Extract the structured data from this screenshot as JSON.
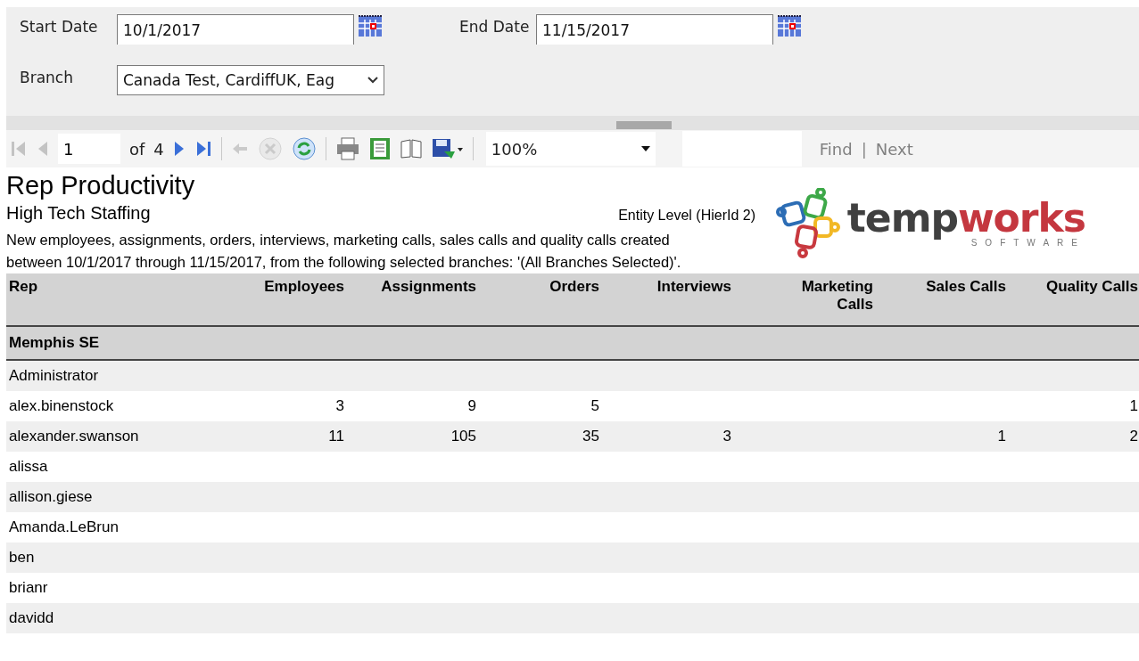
{
  "parameters": {
    "start_date": {
      "label": "Start Date",
      "value": "10/1/2017"
    },
    "end_date": {
      "label": "End Date",
      "value": "11/15/2017"
    },
    "branch": {
      "label": "Branch",
      "value": "Canada Test, CardiffUK, Eag"
    }
  },
  "toolbar": {
    "page": "1",
    "of": "of",
    "total": "4",
    "nav": [
      {
        "kind": "first",
        "disabled": true
      },
      {
        "kind": "prev",
        "disabled": true
      },
      {
        "kind": "next",
        "disabled": false
      },
      {
        "kind": "last",
        "disabled": false
      }
    ],
    "actions": [
      {
        "kind": "back",
        "disabled": true
      },
      {
        "kind": "stop",
        "disabled": true
      },
      {
        "kind": "refresh",
        "disabled": false
      },
      {
        "kind": "sep"
      },
      {
        "kind": "print",
        "disabled": false
      },
      {
        "kind": "page-setup",
        "disabled": false
      },
      {
        "kind": "layout",
        "disabled": false
      },
      {
        "kind": "export",
        "disabled": false
      }
    ],
    "zoom": "100%",
    "find": "Find",
    "find_sep": "|",
    "next": "Next"
  },
  "report": {
    "title": "Rep Productivity",
    "company": "High Tech Staffing",
    "entity_level": "Entity Level (HierId 2)",
    "description": "New employees, assignments, orders, interviews, marketing calls, sales calls and quality calls created between 10/1/2017 through 11/15/2017, from the following selected branches: '(All Branches Selected)'.",
    "logo": {
      "word_a": "temp",
      "word_b": "works",
      "tagline": "SOFTWARE"
    }
  },
  "table": {
    "columns": [
      "Rep",
      "Employees",
      "Assignments",
      "Orders",
      "Interviews",
      "Marketing Calls",
      "Sales Calls",
      "Quality Calls"
    ],
    "group": "Memphis SE",
    "rows": [
      [
        "Administrator",
        "",
        "",
        "",
        "",
        "",
        "",
        ""
      ],
      [
        "alex.binenstock",
        "3",
        "9",
        "5",
        "",
        "",
        "",
        "1"
      ],
      [
        "alexander.swanson",
        "11",
        "105",
        "35",
        "3",
        "",
        "1",
        "2"
      ],
      [
        "alissa",
        "",
        "",
        "",
        "",
        "",
        "",
        ""
      ],
      [
        "allison.giese",
        "",
        "",
        "",
        "",
        "",
        "",
        ""
      ],
      [
        "Amanda.LeBrun",
        "",
        "",
        "",
        "",
        "",
        "",
        ""
      ],
      [
        "ben",
        "",
        "",
        "",
        "",
        "",
        "",
        ""
      ],
      [
        "brianr",
        "",
        "",
        "",
        "",
        "",
        "",
        ""
      ],
      [
        "davidd",
        "",
        "",
        "",
        "",
        "",
        "",
        ""
      ]
    ]
  }
}
